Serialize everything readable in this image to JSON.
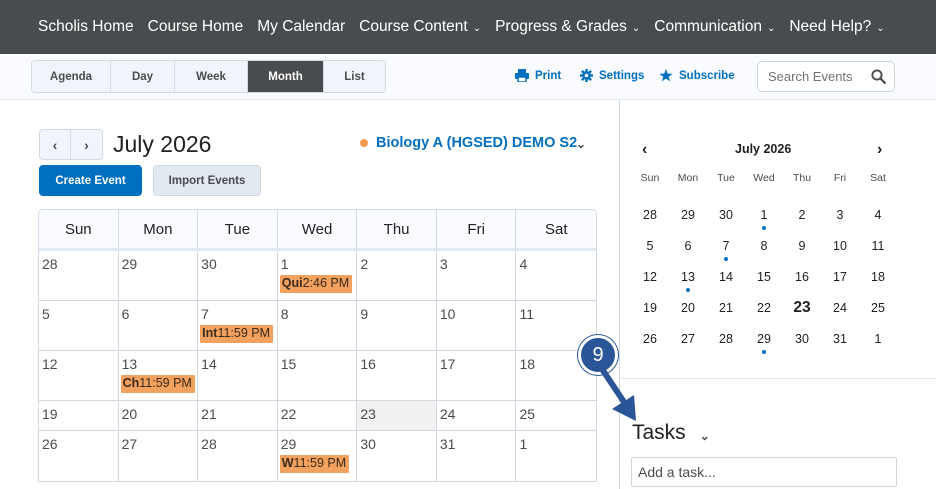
{
  "topnav": {
    "items": [
      {
        "label": "Scholis Home",
        "dropdown": false
      },
      {
        "label": "Course Home",
        "dropdown": false
      },
      {
        "label": "My Calendar",
        "dropdown": false
      },
      {
        "label": "Course Content",
        "dropdown": true
      },
      {
        "label": "Progress & Grades",
        "dropdown": true
      },
      {
        "label": "Communication",
        "dropdown": true
      },
      {
        "label": "Need Help?",
        "dropdown": true
      }
    ]
  },
  "toolbar": {
    "views": [
      "Agenda",
      "Day",
      "Week",
      "Month",
      "List"
    ],
    "active_view": "Month",
    "print_label": "Print",
    "settings_label": "Settings",
    "subscribe_label": "Subscribe",
    "search_placeholder": "Search Events"
  },
  "calendar": {
    "month_title": "July 2026",
    "course_name": "Biology A (HGSED) DEMO S2",
    "course_color": "#f39b4d",
    "create_event_label": "Create Event",
    "import_events_label": "Import Events",
    "weekdays": [
      "Sun",
      "Mon",
      "Tue",
      "Wed",
      "Thu",
      "Fri",
      "Sat"
    ],
    "weeks": [
      [
        {
          "d": "28"
        },
        {
          "d": "29"
        },
        {
          "d": "30"
        },
        {
          "d": "1",
          "event": {
            "name": "Qui",
            "time": "2:46 PM"
          }
        },
        {
          "d": "2"
        },
        {
          "d": "3"
        },
        {
          "d": "4"
        }
      ],
      [
        {
          "d": "5"
        },
        {
          "d": "6"
        },
        {
          "d": "7",
          "event": {
            "name": "Int",
            "time": "11:59 PM"
          }
        },
        {
          "d": "8"
        },
        {
          "d": "9"
        },
        {
          "d": "10"
        },
        {
          "d": "11"
        }
      ],
      [
        {
          "d": "12"
        },
        {
          "d": "13",
          "event": {
            "name": "Ch",
            "time": "11:59 PM"
          }
        },
        {
          "d": "14"
        },
        {
          "d": "15"
        },
        {
          "d": "16"
        },
        {
          "d": "17"
        },
        {
          "d": "18"
        }
      ],
      [
        {
          "d": "19"
        },
        {
          "d": "20"
        },
        {
          "d": "21"
        },
        {
          "d": "22"
        },
        {
          "d": "23",
          "today": true
        },
        {
          "d": "24"
        },
        {
          "d": "25"
        }
      ],
      [
        {
          "d": "26"
        },
        {
          "d": "27"
        },
        {
          "d": "28"
        },
        {
          "d": "29",
          "event": {
            "name": "W",
            "time": "11:59 PM"
          }
        },
        {
          "d": "30"
        },
        {
          "d": "31"
        },
        {
          "d": "1"
        }
      ]
    ],
    "event_color": "#f2a15f"
  },
  "mini_calendar": {
    "title": "July 2026",
    "weekdays": [
      "Sun",
      "Mon",
      "Tue",
      "Wed",
      "Thu",
      "Fri",
      "Sat"
    ],
    "weeks": [
      [
        {
          "d": "28"
        },
        {
          "d": "29"
        },
        {
          "d": "30"
        },
        {
          "d": "1",
          "dot": true
        },
        {
          "d": "2"
        },
        {
          "d": "3"
        },
        {
          "d": "4"
        }
      ],
      [
        {
          "d": "5"
        },
        {
          "d": "6"
        },
        {
          "d": "7",
          "dot": true
        },
        {
          "d": "8"
        },
        {
          "d": "9"
        },
        {
          "d": "10"
        },
        {
          "d": "11"
        }
      ],
      [
        {
          "d": "12"
        },
        {
          "d": "13",
          "dot": true
        },
        {
          "d": "14"
        },
        {
          "d": "15"
        },
        {
          "d": "16"
        },
        {
          "d": "17"
        },
        {
          "d": "18"
        }
      ],
      [
        {
          "d": "19"
        },
        {
          "d": "20"
        },
        {
          "d": "21"
        },
        {
          "d": "22"
        },
        {
          "d": "23",
          "today": true
        },
        {
          "d": "24"
        },
        {
          "d": "25"
        }
      ],
      [
        {
          "d": "26"
        },
        {
          "d": "27"
        },
        {
          "d": "28"
        },
        {
          "d": "29",
          "dot": true
        },
        {
          "d": "30"
        },
        {
          "d": "31"
        },
        {
          "d": "1"
        }
      ]
    ]
  },
  "tasks": {
    "title": "Tasks",
    "input_placeholder": "Add a task..."
  },
  "annotation": {
    "step_number": "9",
    "color": "#2a5596"
  },
  "colors": {
    "nav_bg": "#494c4e",
    "accent": "#006fbf"
  }
}
